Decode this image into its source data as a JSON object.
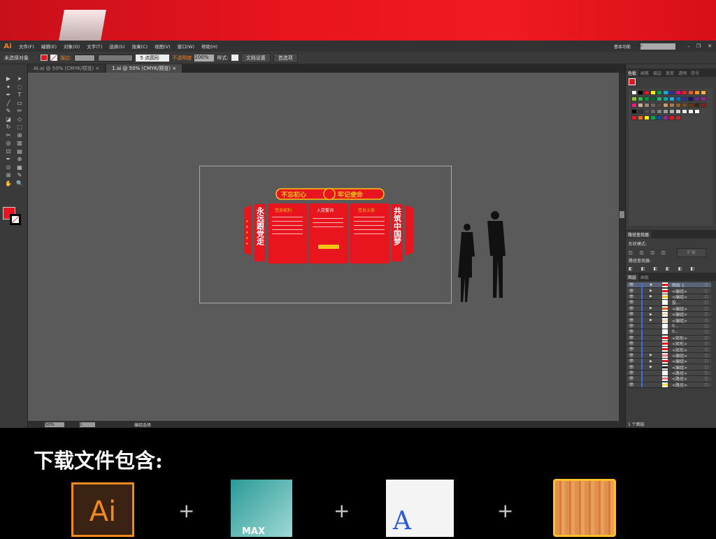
{
  "app": {
    "logo": "Ai",
    "menu": [
      "文件(F)",
      "编辑(E)",
      "对象(O)",
      "文字(T)",
      "选择(S)",
      "效果(C)",
      "视图(V)",
      "窗口(W)",
      "帮助(H)"
    ],
    "workspace": "基本功能",
    "search_icon": "search-icon"
  },
  "control": {
    "selection": "未选择对象",
    "stroke_label": "描边:",
    "brush": "5 点圆形",
    "opacity_label": "不透明度",
    "opacity": "100%",
    "style_label": "样式:",
    "doc_setup": "文档设置",
    "prefs": "首选项",
    "fill_color": "#e8141e"
  },
  "tabs": [
    {
      "label": "AI.ai @ 50% (CMYK/预览)",
      "active": false
    },
    {
      "label": "1.ai @ 50% (CMYK/预览)",
      "active": true
    }
  ],
  "artwork": {
    "banner_left": "不忘初心",
    "banner_right": "牢记使命",
    "side_left": "永远跟党走",
    "side_right": "共筑中国梦",
    "panel1": "党员权利",
    "panel2": "入党誓词",
    "panel3": "党员义务",
    "red": "#e8141e",
    "gold": "#f5c518"
  },
  "status": {
    "zoom": "50%",
    "page": "1",
    "tool": "编组选择"
  },
  "panels": {
    "swatch_tabs": [
      "色板",
      "画笔",
      "描边",
      "渐变",
      "透明",
      "符号"
    ],
    "swatch_colors": [
      "#ffffff",
      "#000000",
      "#e8141e",
      "#fff200",
      "#00a650",
      "#00aeef",
      "#2e3192",
      "#ec008c",
      "#ed1c24",
      "#f15a24",
      "#f7931e",
      "#fbb03b",
      "#fcee21",
      "#d9e021",
      "#8cc63f",
      "#39b54a",
      "#009245",
      "#006837",
      "#22b573",
      "#00a99d",
      "#29abe2",
      "#0071bc",
      "#2e3192",
      "#1b1464",
      "#662d91",
      "#93278f",
      "#9e005d",
      "#d4145a",
      "#ed1e79",
      "#c7b299",
      "#998675",
      "#736357",
      "#534741",
      "#c69c6d",
      "#a67c52",
      "#8c6239",
      "#754c24",
      "#603813",
      "#42210b",
      "#8b1a1a",
      "#c1272d",
      "#a0522d"
    ],
    "grays": [
      "#000000",
      "#333333",
      "#4d4d4d",
      "#666666",
      "#808080",
      "#999999",
      "#b3b3b3",
      "#cccccc",
      "#e6e6e6",
      "#f2f2f2",
      "#ffffff"
    ],
    "group_colors": [
      "#ed1c24",
      "#f26522",
      "#fff200",
      "#00a651",
      "#0054a6",
      "#92278f",
      "#e8141e",
      "#c1272d"
    ],
    "pathfinder_title": "路径查找器",
    "shape_modes": "形状模式:",
    "expand": "扩展",
    "pathfinders": "路径查找器:",
    "layer_tabs": [
      "图层",
      "画板"
    ],
    "layers": [
      {
        "name": "图层 1",
        "thumb": "#e8141e",
        "expand": "▼",
        "top": true
      },
      {
        "name": "<编组>",
        "thumb": "#e8141e",
        "expand": "▶"
      },
      {
        "name": "<编组>",
        "thumb": "#f5c518",
        "expand": "▶"
      },
      {
        "name": "投...",
        "thumb": "#ffffff",
        "expand": ""
      },
      {
        "name": "<编组>",
        "thumb": "#e86a1e",
        "expand": "▶"
      },
      {
        "name": "<编组>",
        "thumb": "#f0d8b0",
        "expand": "▶"
      },
      {
        "name": "<编组>",
        "thumb": "#f0d8b0",
        "expand": "▶"
      },
      {
        "name": "0...",
        "thumb": "#ffffff",
        "expand": ""
      },
      {
        "name": "0...",
        "thumb": "#ffffff",
        "expand": ""
      },
      {
        "name": "<矩形>",
        "thumb": "#e8141e",
        "expand": ""
      },
      {
        "name": "<矩形>",
        "thumb": "#e8141e",
        "expand": ""
      },
      {
        "name": "<矩形>",
        "thumb": "#e8141e",
        "expand": ""
      },
      {
        "name": "<编组>",
        "thumb": "#f08080",
        "expand": "▶"
      },
      {
        "name": "<编组>",
        "thumb": "#e8141e",
        "expand": "▶"
      },
      {
        "name": "<编组>",
        "thumb": "#222222",
        "expand": "▶"
      },
      {
        "name": "<路径>",
        "thumb": "#ffffff",
        "expand": ""
      },
      {
        "name": "<路径>",
        "thumb": "#f08080",
        "expand": ""
      },
      {
        "name": "<路径>",
        "thumb": "#f5e050",
        "expand": ""
      }
    ],
    "layer_count": "1 个图层"
  },
  "promo": {
    "title": "下载文件包含:",
    "items": [
      "Ai",
      "MAX",
      "A"
    ],
    "plus": "+"
  }
}
